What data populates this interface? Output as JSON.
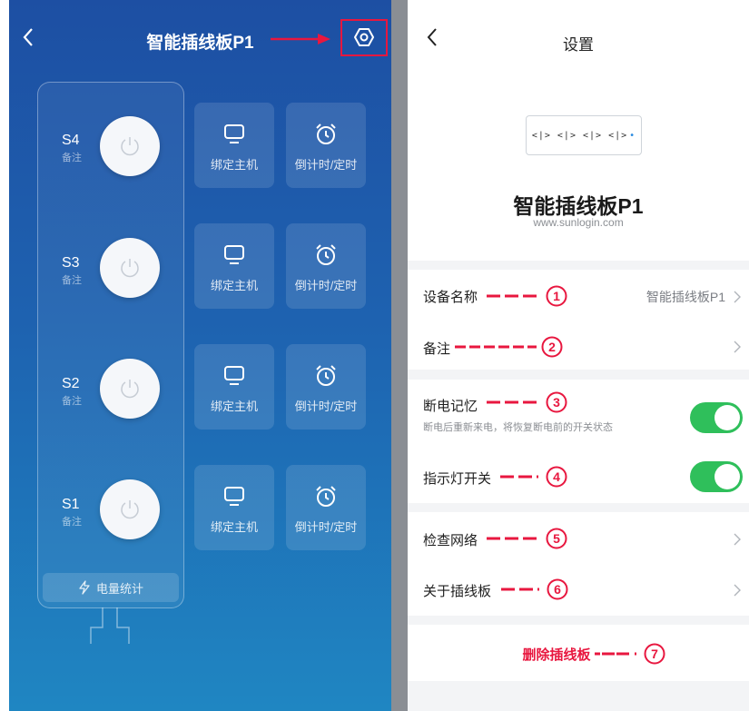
{
  "left": {
    "title": "智能插线板P1",
    "sockets": [
      {
        "id": "S4",
        "note": "备注",
        "bind_label": "绑定主机",
        "timer_label": "倒计时/定时"
      },
      {
        "id": "S3",
        "note": "备注",
        "bind_label": "绑定主机",
        "timer_label": "倒计时/定时"
      },
      {
        "id": "S2",
        "note": "备注",
        "bind_label": "绑定主机",
        "timer_label": "倒计时/定时"
      },
      {
        "id": "S1",
        "note": "备注",
        "bind_label": "绑定主机",
        "timer_label": "倒计时/定时"
      }
    ],
    "stats_label": "电量统计"
  },
  "right": {
    "title": "设置",
    "device_name": "智能插线板P1",
    "device_url": "www.sunlogin.com",
    "device_image_text": "<|> <|> <|> <|>",
    "rows": {
      "name_label": "设备名称",
      "name_value": "智能插线板P1",
      "remark_label": "备注",
      "memory_label": "断电记忆",
      "memory_desc": "断电后重新来电，将恢复断电前的开关状态",
      "indicator_label": "指示灯开关",
      "network_label": "检查网络",
      "about_label": "关于插线板",
      "delete_label": "删除插线板"
    },
    "toggles": {
      "memory_on": true,
      "indicator_on": true
    },
    "annotations": [
      "1",
      "2",
      "3",
      "4",
      "5",
      "6",
      "7"
    ]
  },
  "colors": {
    "accent_red": "#e8173f",
    "toggle_green": "#2fbf5b",
    "panel_blue_top": "#1d4fa3",
    "panel_blue_bottom": "#1f86c2"
  },
  "icons": [
    "back-icon",
    "settings-hex-icon",
    "power-icon",
    "monitor-icon",
    "alarm-clock-icon",
    "lightning-icon",
    "chevron-right-icon"
  ]
}
